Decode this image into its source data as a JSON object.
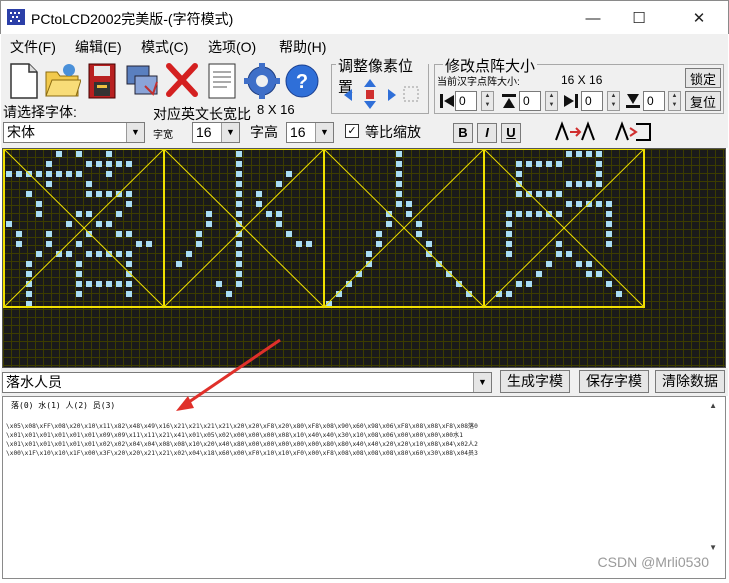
{
  "window": {
    "title": "PCtoLCD2002完美版-(字符模式)",
    "minimize": "—",
    "maximize": "☐",
    "close": "✕"
  },
  "menu": [
    "文件(F)",
    "编辑(E)",
    "模式(C)",
    "选项(O)",
    "帮助(H)"
  ],
  "toolbar": {
    "icons": [
      "new-file-icon",
      "open-folder-icon",
      "save-disk-icon",
      "import-icon",
      "delete-x-icon",
      "document-icon",
      "settings-gear-icon",
      "help-icon"
    ],
    "adjust_title": "调整像素位置",
    "size_title": "修改点阵大小",
    "size_sub_label": "当前汉字点阵大小:",
    "size_value": "16 X 16",
    "lock_btn": "锁定",
    "reset_btn": "复位",
    "spin_values": [
      "0",
      "0",
      "0",
      "0"
    ]
  },
  "font": {
    "select_label": "请选择字体:",
    "width_label": "对应英文长宽比",
    "width_value": "8 X 16",
    "font_name": "宋体",
    "kuan_label": "字宽",
    "kuan_value": "16",
    "gao_label": "字高",
    "gao_value": "16",
    "scale_label": "等比缩放",
    "scale_checked": "✓",
    "bold": "B",
    "italic": "I",
    "underline": "U"
  },
  "input": {
    "text": "落水人员",
    "gen_btn": "生成字模",
    "save_btn": "保存字模",
    "clear_btn": "清除数据"
  },
  "output": {
    "header": "落(0) 水(1) 人(2) 员(3)",
    "lines": [
      "\\x05\\x08\\xFF\\x08\\x20\\x10\\x11\\x82\\x48\\x49\\x16\\x21\\x21\\x21\\x21\\x20\\x20\\xF8\\x20\\x80\\xF8\\x08\\x90\\x60\\x98\\x06\\xF8\\x08\\x08\\xF8\\x08落0",
      "\\x01\\x01\\x01\\x01\\x01\\x01\\x09\\x09\\x11\\x11\\x21\\x41\\x01\\x05\\x02\\x00\\x00\\x00\\x08\\x10\\x40\\x40\\x30\\x10\\x08\\x06\\x00\\x00\\x00\\x00水1",
      "\\x01\\x01\\x01\\x01\\x01\\x01\\x02\\x02\\x04\\x04\\x08\\x08\\x10\\x20\\x40\\x80\\x00\\x00\\x00\\x00\\x00\\x80\\x80\\x40\\x40\\x20\\x20\\x10\\x08\\x04\\x02人2",
      "\\x00\\x1F\\x10\\x10\\x1F\\x00\\x3F\\x20\\x20\\x21\\x21\\x02\\x04\\x18\\x60\\x00\\xF0\\x10\\x10\\xF0\\x00\\xF8\\x08\\x08\\x08\\x08\\x80\\x60\\x30\\x08\\x04员3"
    ]
  },
  "watermark": "CSDN @Mrli0530",
  "colors": {
    "lit_pixel": "#a9ddf5",
    "grid_line": "#3c3c00",
    "guide": "#f0e000",
    "arrow": "#e0302a"
  }
}
